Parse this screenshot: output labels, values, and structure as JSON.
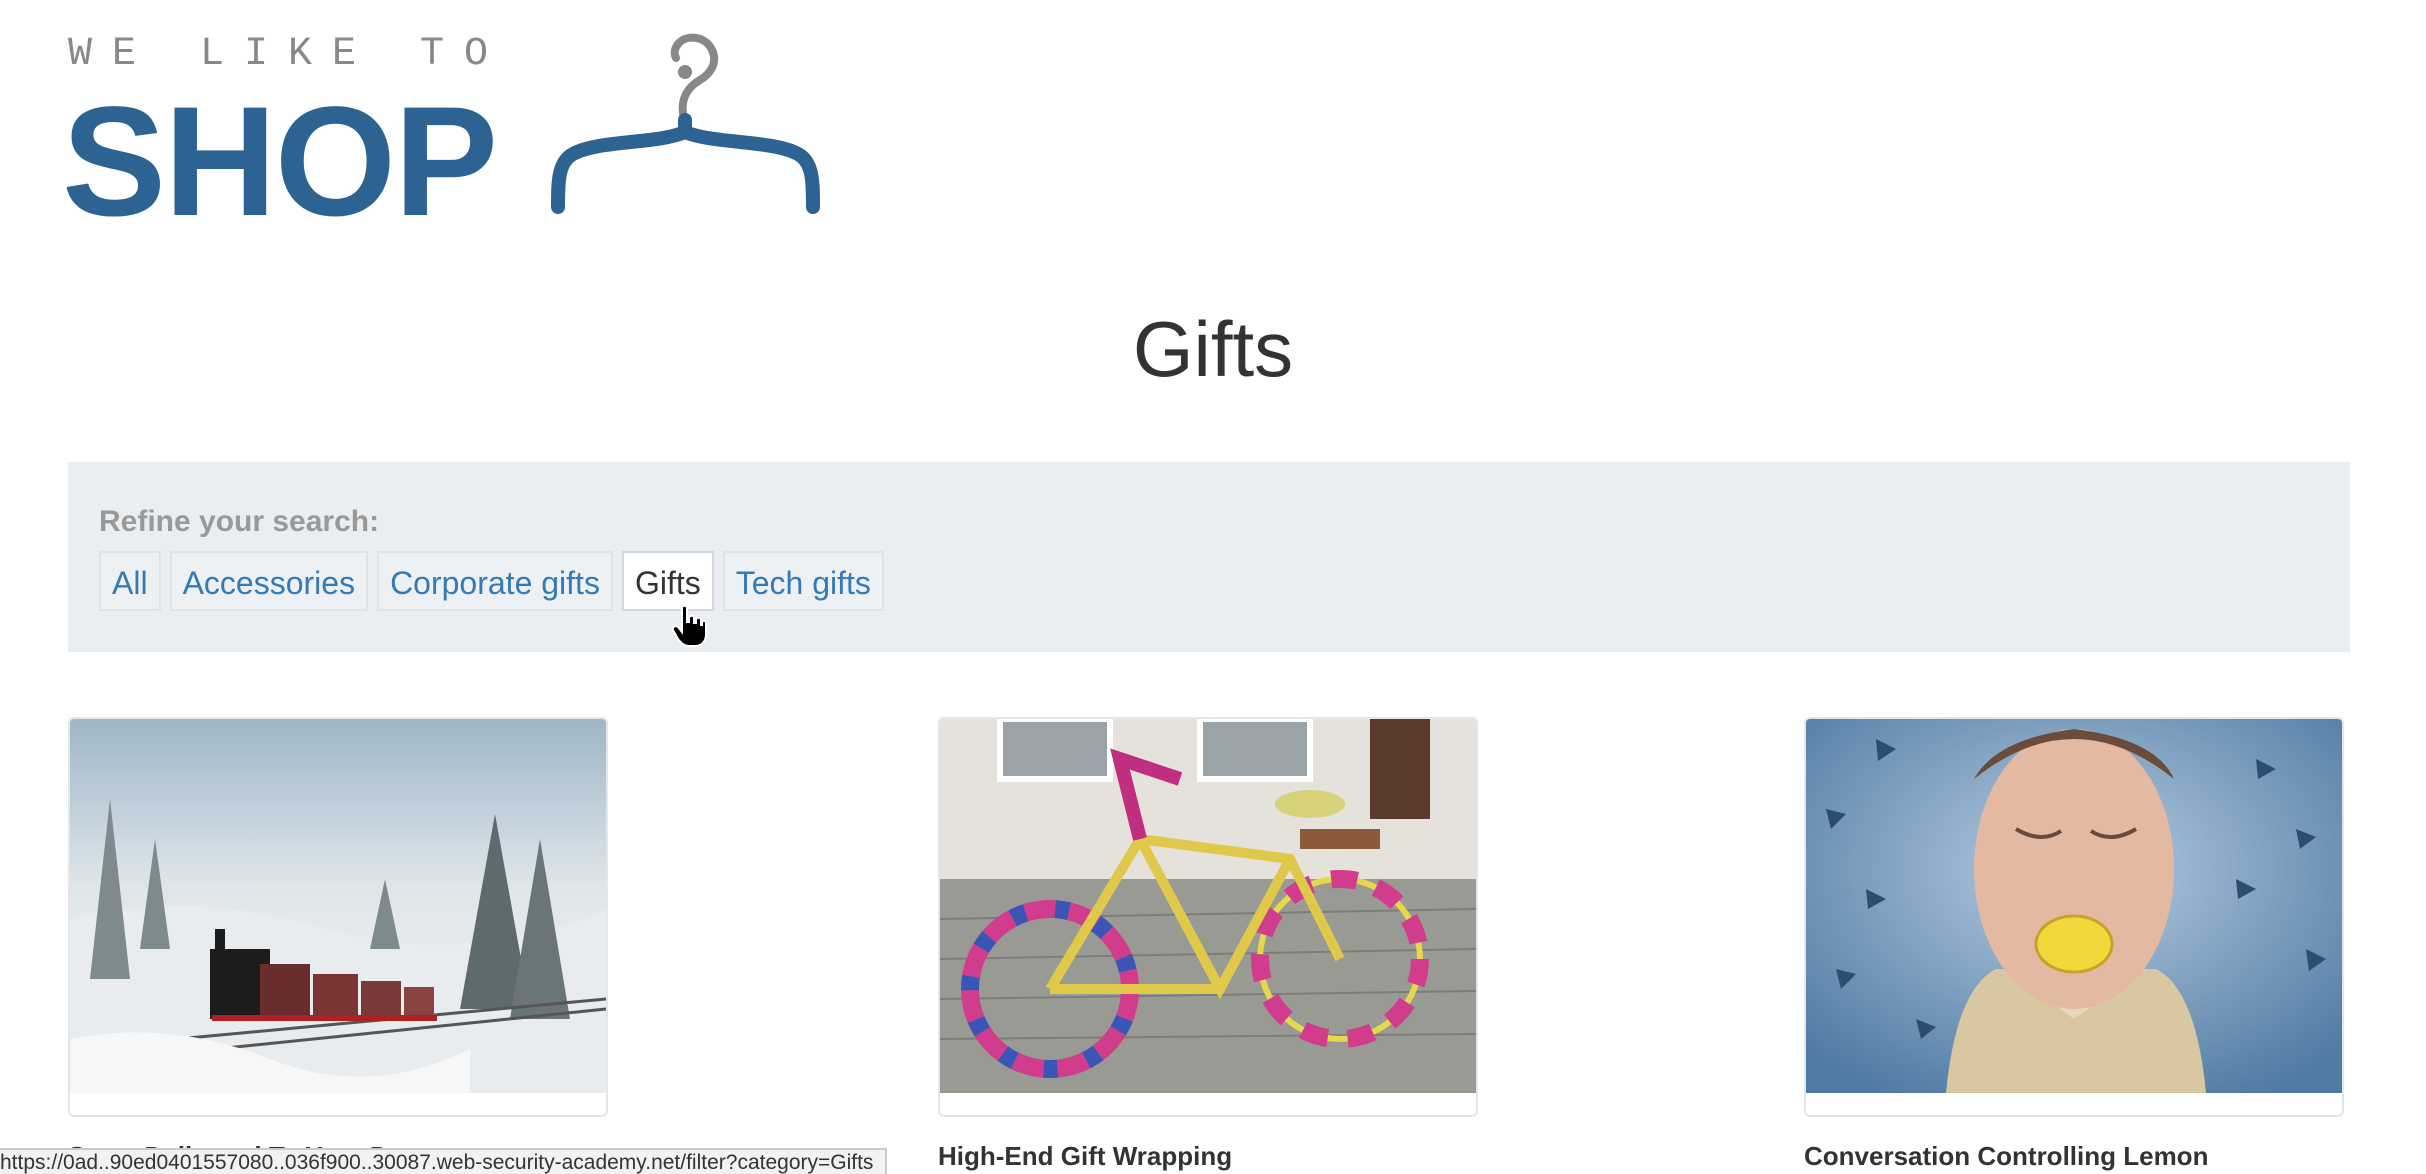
{
  "logo": {
    "top_text": "WE LIKE TO",
    "main_text": "SHOP",
    "brand_color": "#2d6393"
  },
  "page": {
    "title": "Gifts"
  },
  "filters": {
    "label": "Refine your search:",
    "items": [
      {
        "label": "All",
        "active": false
      },
      {
        "label": "Accessories",
        "active": false
      },
      {
        "label": "Corporate gifts",
        "active": false
      },
      {
        "label": "Gifts",
        "active": true
      },
      {
        "label": "Tech gifts",
        "active": false
      }
    ],
    "link_color": "#337ab7"
  },
  "products": [
    {
      "name": "Snow Delivered To Your Door",
      "image": "steam-train-in-snow-image"
    },
    {
      "name": "High-End Gift Wrapping",
      "image": "yarn-bombed-bicycle-image"
    },
    {
      "name": "Conversation Controlling Lemon",
      "image": "man-biting-lemon-image"
    }
  ],
  "status_bar": {
    "url": "https://0ad..90ed0401557080..036f900..30087.web-security-academy.net/filter?category=Gifts"
  }
}
